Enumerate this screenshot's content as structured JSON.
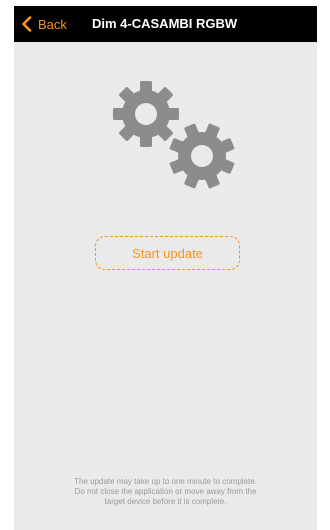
{
  "navbar": {
    "back_label": "Back",
    "back_icon": "chevron-left-icon",
    "title": "Dim 4-CASAMBI RGBW"
  },
  "main": {
    "illustration_icon": "gears-icon",
    "start_update_label": "Start update",
    "footer_note": "The update may take up to one minute to complete. Do not close the application or move away from the target device before it is complete."
  },
  "colors": {
    "accent": "#f7941d",
    "navbar_bg": "#000000",
    "content_bg": "#eaeaea",
    "gear": "#8c8c8c",
    "note_text": "#9a9a9a"
  }
}
